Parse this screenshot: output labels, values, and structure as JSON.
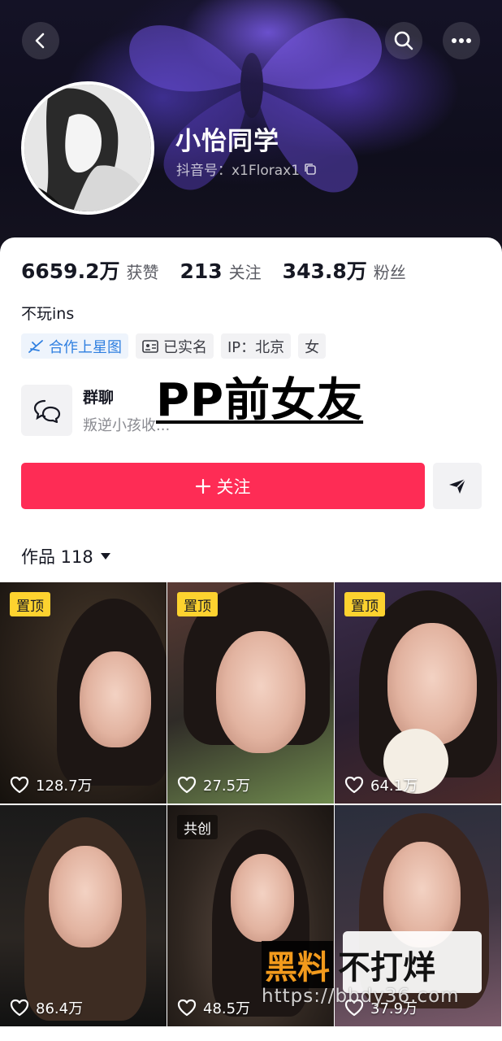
{
  "profile": {
    "nickname": "小怡同学",
    "douyin_id": "抖音号：x1Florax1",
    "bio": "不玩ins"
  },
  "stats": [
    {
      "value": "6659.2万",
      "label": "获赞"
    },
    {
      "value": "213",
      "label": "关注"
    },
    {
      "value": "343.8万",
      "label": "粉丝"
    }
  ],
  "tags": [
    {
      "label": "合作上星图",
      "icon": "star-map-icon",
      "style": "blue"
    },
    {
      "label": "已实名",
      "icon": "id-card-icon",
      "style": "gray"
    },
    {
      "label": "IP：北京",
      "icon": "",
      "style": "gray"
    },
    {
      "label": "女",
      "icon": "",
      "style": "gray"
    }
  ],
  "group_chat": {
    "title": "群聊",
    "subtitle": "叛逆小孩收..."
  },
  "overlay_caption": "PP前女友",
  "actions": {
    "follow_label": "关注",
    "follow_icon": "plus-icon",
    "share_icon": "send-icon"
  },
  "works_tab": {
    "label": "作品 118"
  },
  "videos": [
    {
      "likes": "128.7万",
      "badge": "置顶",
      "badge_type": "pinned"
    },
    {
      "likes": "27.5万",
      "badge": "置顶",
      "badge_type": "pinned"
    },
    {
      "likes": "64.1万",
      "badge": "置顶",
      "badge_type": "pinned"
    },
    {
      "likes": "86.4万",
      "badge": "",
      "badge_type": ""
    },
    {
      "likes": "48.5万",
      "badge": "共创",
      "badge_type": "collab"
    },
    {
      "likes": "37.9万",
      "badge": "",
      "badge_type": ""
    }
  ],
  "watermark": {
    "brand_a": "黑料",
    "brand_b": "不打烊",
    "url": "https://bbdy36.com"
  },
  "colors": {
    "follow_red": "#fe2c55",
    "pinned_yellow": "#fdd22f",
    "tag_blue": "#2f7fe0"
  }
}
